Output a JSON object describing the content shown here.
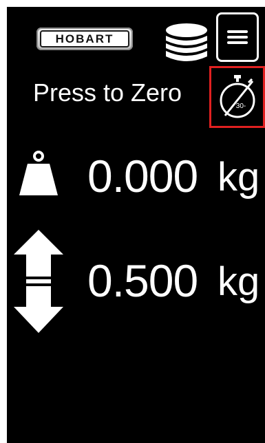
{
  "header": {
    "brand_logo": "HOBART",
    "database_icon": "database-icon",
    "menu_icon": "hamburger-menu-icon"
  },
  "zero": {
    "label": "Press to Zero",
    "timer_icon": "stopwatch-icon",
    "timer_text": "30-"
  },
  "readings": {
    "net_weight": {
      "icon": "weight-icon",
      "value": "0.000",
      "unit": "kg"
    },
    "tare": {
      "icon": "up-down-arrows-icon",
      "value": "0.500",
      "unit": "kg"
    }
  },
  "colors": {
    "background": "#000000",
    "foreground": "#ffffff",
    "highlight": "#e02020"
  }
}
